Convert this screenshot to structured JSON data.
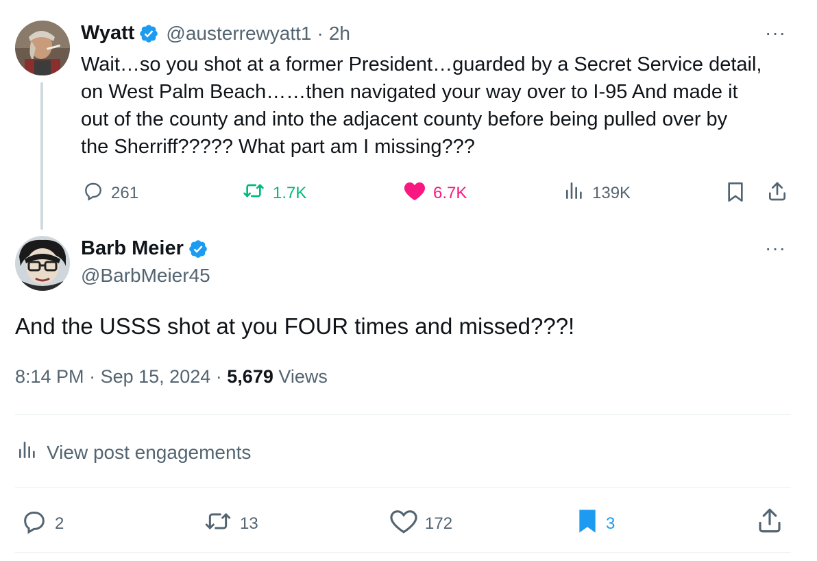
{
  "parent": {
    "name": "Wyatt",
    "handle": "@austerrewyatt1",
    "separator": "·",
    "time": "2h",
    "text": "Wait...so you shot at a former President...guarded by a Secret Service detail, on West Palm Beach......then navigated your way over to I-95 And made it out of the county and into the adjacent county before being pulled over by the Sherriff????? What part am I missing???",
    "lines": [
      "Wait…so you shot at a former President…guarded by a Secret Service detail,",
      "on West Palm Beach……then navigated your way over to I-95 And made it",
      "out of the county and into the adjacent county before being pulled over by",
      "the Sherriff????? What part am I missing???"
    ],
    "stats": {
      "replies": "261",
      "reposts": "1.7K",
      "likes": "6.7K",
      "views": "139K"
    },
    "more": "···"
  },
  "main": {
    "name": "Barb Meier",
    "handle": "@BarbMeier45",
    "text": "And the USSS shot at you FOUR times and missed???!",
    "time": "8:14 PM",
    "sep1": "·",
    "date": "Sep 15, 2024",
    "sep2": "·",
    "views_count": "5,679",
    "views_label": "Views",
    "engagements_label": "View post engagements",
    "stats": {
      "replies": "2",
      "reposts": "13",
      "likes": "172",
      "bookmarks": "3"
    },
    "more": "···"
  },
  "colors": {
    "verified": "#1d9bf0",
    "repost_active": "#00ba7c",
    "like_active": "#f91880",
    "bookmark_active": "#1d9bf0",
    "muted": "#536471",
    "text": "#0f1419"
  },
  "icons": [
    "verified-badge-icon",
    "reply-icon",
    "repost-icon",
    "like-icon",
    "views-icon",
    "bookmark-icon",
    "share-icon",
    "more-icon",
    "analytics-icon"
  ]
}
